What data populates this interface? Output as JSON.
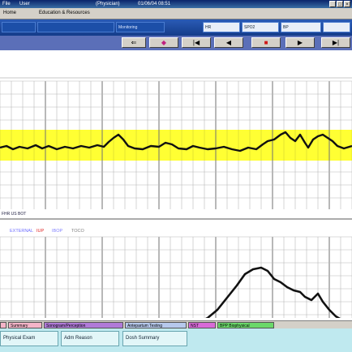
{
  "window": {
    "title_left": "File",
    "title_user": "User",
    "title_role": "(Physician)",
    "title_date": "01/06/04 08:51",
    "buttons": [
      "_",
      "□",
      "×"
    ]
  },
  "menu": {
    "items": [
      "Home",
      "Education & Resources"
    ]
  },
  "header": {
    "patient_field": "",
    "status_field": "Monitoring",
    "field_a": "HR",
    "field_b": "SPO2",
    "field_c": "BP"
  },
  "controls": {
    "buttons": [
      "⇐",
      "◆",
      "|◀",
      "◀",
      "■",
      "▶",
      "▶|"
    ]
  },
  "upper_strip": {
    "label": "FHR  US   BOT"
  },
  "lower_strip": {
    "label": "EXTERNAL",
    "label_toco_a": "IUP",
    "label_toco_b": "IBOP",
    "label_toco_c": "TOCO"
  },
  "tabs": [
    {
      "label": "Summary",
      "bg": "#f4b4c8"
    },
    {
      "label": "Sonogram/Perception",
      "bg": "#b07ad8"
    },
    {
      "label": "Antepartum Testing",
      "bg": "#b6c8ec"
    },
    {
      "label": "NST",
      "bg": "#d86ad8"
    },
    {
      "label": "BPP Biophysical",
      "bg": "#6ad86a"
    }
  ],
  "bottom_buttons": [
    "Physical Exam",
    "Adm Reason",
    "Dosh Summary"
  ],
  "colors": {
    "band": "#ffff33",
    "trace": "#111111",
    "grid": "#909090"
  }
}
